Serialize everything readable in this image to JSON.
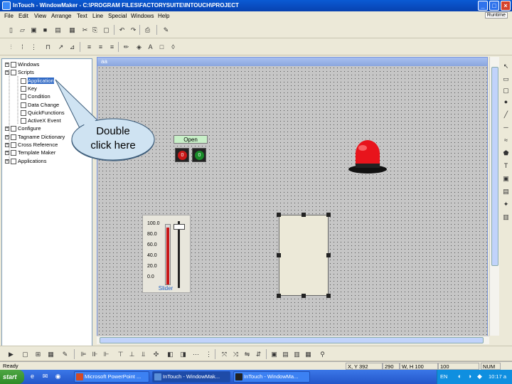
{
  "window": {
    "title": "InTouch - WindowMaker - C:\\PROGRAM FILES\\FACTORYSUITE\\INTOUCH\\PROJECT",
    "frame_label": "Runtime"
  },
  "menu": [
    "File",
    "Edit",
    "View",
    "Arrange",
    "Text",
    "Line",
    "Special",
    "Windows",
    "Help"
  ],
  "tree": {
    "items": [
      {
        "label": "Windows",
        "indent": 0
      },
      {
        "label": "Scripts",
        "indent": 0
      },
      {
        "label": "Application",
        "indent": 1,
        "selected": true
      },
      {
        "label": "Key",
        "indent": 1
      },
      {
        "label": "Condition",
        "indent": 1
      },
      {
        "label": "Data Change",
        "indent": 1
      },
      {
        "label": "QuickFunctions",
        "indent": 1
      },
      {
        "label": "ActiveX Event",
        "indent": 1
      },
      {
        "label": "Configure",
        "indent": 0
      },
      {
        "label": "Tagname Dictionary",
        "indent": 0
      },
      {
        "label": "Cross Reference",
        "indent": 0
      },
      {
        "label": "Template Maker",
        "indent": 0
      },
      {
        "label": "Applications",
        "indent": 0
      }
    ]
  },
  "callout": {
    "text": "Double\nclick here"
  },
  "canvas": {
    "title": "aa"
  },
  "open_panel": {
    "label": "Open",
    "btn_stop": "0",
    "btn_start": "0"
  },
  "slider": {
    "ticks": [
      "100.0",
      "80.0",
      "60.0",
      "40.0",
      "20.0",
      "0.0"
    ],
    "label": "Slider",
    "level": 0.95
  },
  "status": {
    "ready": "Ready",
    "xy_label": "X, Y",
    "x": "392",
    "y": "290",
    "wh_label": "W, H",
    "w": "100",
    "h": "100",
    "num": "NUM"
  },
  "taskbar": {
    "start": "start",
    "tasks": [
      "Microsoft PowerPoint ...",
      "InTouch - WindowMak...",
      "InTouch - WindowMa..."
    ],
    "tray_lang": "EN",
    "clock": "10:17 a"
  },
  "colors": {
    "titlebar": "#0a5ad4",
    "selection": "#316ac5",
    "lamp": "#e8141c"
  }
}
